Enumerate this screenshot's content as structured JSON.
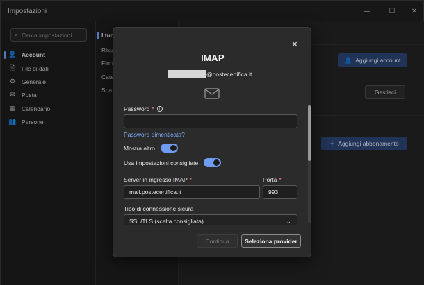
{
  "window": {
    "title": "Impostazioni",
    "controls": {
      "minimize": "—",
      "maximize": "☐",
      "close": "✕"
    }
  },
  "nav": {
    "search_placeholder": "Cerca impostazioni",
    "items": [
      {
        "label": "Account",
        "icon": "person-icon",
        "glyph": "👤"
      },
      {
        "label": "File di dati",
        "icon": "file-icon",
        "glyph": "🗎"
      },
      {
        "label": "Generale",
        "icon": "gear-icon",
        "glyph": "⚙"
      },
      {
        "label": "Posta",
        "icon": "mail-icon",
        "glyph": "✉"
      },
      {
        "label": "Calendario",
        "icon": "calendar-icon",
        "glyph": "▦"
      },
      {
        "label": "Persone",
        "icon": "people-icon",
        "glyph": "👥"
      }
    ]
  },
  "mid": {
    "items": [
      "I tuo",
      "Rispo",
      "Firme",
      "Categ",
      "Spaz"
    ]
  },
  "right": {
    "add_account_label": "Aggiungi account",
    "manage_label": "Gestisci",
    "add_subscription_label": "Aggiungi abbonamento"
  },
  "modal": {
    "title": "IMAP",
    "email_suffix": "@postecertifica.it",
    "password_label": "Password",
    "password_value": "",
    "forgot_password": "Password dimenticata?",
    "show_more_label": "Mostra altro",
    "recommended_label": "Usa impostazioni consigliate",
    "server_label": "Server in ingresso IMAP",
    "server_value": "mail.postecertifica.it",
    "port_label": "Porta",
    "port_value": "993",
    "security_label": "Tipo di connessione sicura",
    "security_value": "SSL/TLS (scelta consigliata)",
    "continue_label": "Continua",
    "select_provider_label": "Seleziona provider",
    "required_mark": "*"
  }
}
